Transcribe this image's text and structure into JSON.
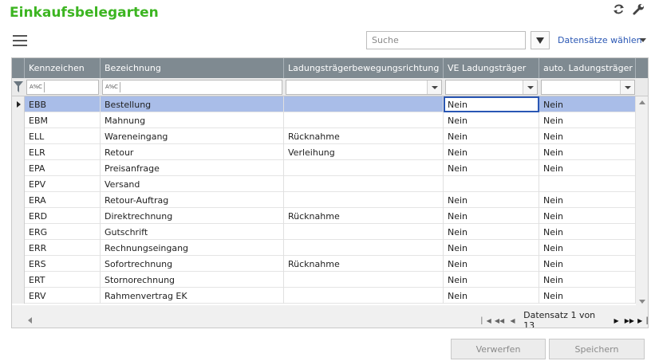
{
  "page": {
    "title": "Einkaufsbelegarten"
  },
  "icons": {
    "refresh": "refresh-icon",
    "settings": "wrench-icon",
    "menu": "hamburger-menu-icon",
    "filter": "filter-funnel-icon"
  },
  "toolbar": {
    "search_placeholder": "Suche",
    "select_records_label": "Datensätze wählen"
  },
  "colors": {
    "title_green": "#3cb521",
    "header_gray": "#7f8a91",
    "selection_blue": "#a9bde8",
    "link_blue": "#2a57b4"
  },
  "grid": {
    "columns": [
      "Kennzeichen",
      "Bezeichnung",
      "Ladungsträgerbewegungsrichtung",
      "VE Ladungsträger",
      "auto. Ladungsträger"
    ],
    "filter_text_hint": "A%C",
    "rows": [
      {
        "code": "EBB",
        "name": "Bestellung",
        "direction": "",
        "ve": "Nein",
        "auto": "Nein"
      },
      {
        "code": "EBM",
        "name": "Mahnung",
        "direction": "",
        "ve": "Nein",
        "auto": "Nein"
      },
      {
        "code": "ELL",
        "name": "Wareneingang",
        "direction": "Rücknahme",
        "ve": "Nein",
        "auto": "Nein"
      },
      {
        "code": "ELR",
        "name": "Retour",
        "direction": "Verleihung",
        "ve": "Nein",
        "auto": "Nein"
      },
      {
        "code": "EPA",
        "name": "Preisanfrage",
        "direction": "",
        "ve": "Nein",
        "auto": "Nein"
      },
      {
        "code": "EPV",
        "name": "Versand",
        "direction": "",
        "ve": "",
        "auto": ""
      },
      {
        "code": "ERA",
        "name": "Retour-Auftrag",
        "direction": "",
        "ve": "Nein",
        "auto": "Nein"
      },
      {
        "code": "ERD",
        "name": "Direktrechnung",
        "direction": "Rücknahme",
        "ve": "Nein",
        "auto": "Nein"
      },
      {
        "code": "ERG",
        "name": "Gutschrift",
        "direction": "",
        "ve": "Nein",
        "auto": "Nein"
      },
      {
        "code": "ERR",
        "name": "Rechnungseingang",
        "direction": "",
        "ve": "Nein",
        "auto": "Nein"
      },
      {
        "code": "ERS",
        "name": "Sofortrechnung",
        "direction": "Rücknahme",
        "ve": "Nein",
        "auto": "Nein"
      },
      {
        "code": "ERT",
        "name": "Stornorechnung",
        "direction": "",
        "ve": "Nein",
        "auto": "Nein"
      },
      {
        "code": "ERV",
        "name": "Rahmenvertrag EK",
        "direction": "",
        "ve": "Nein",
        "auto": "Nein"
      }
    ],
    "selected_row": 0,
    "pager_text": "Datensatz 1 von 13"
  },
  "actions": {
    "discard_label": "Verwerfen",
    "save_label": "Speichern"
  }
}
